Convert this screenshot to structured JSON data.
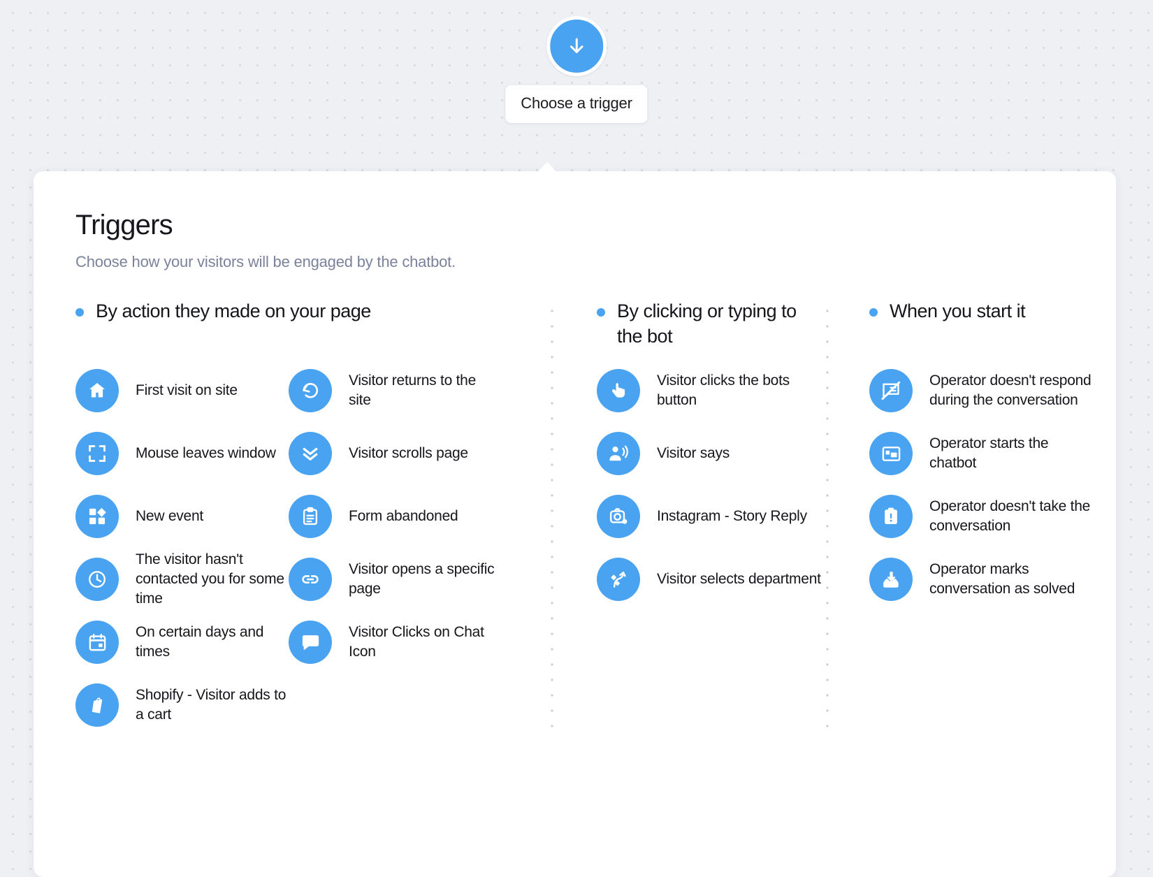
{
  "colors": {
    "accent": "#4aa3f0",
    "card_bg": "#ffffff",
    "page_bg": "#eef0f4",
    "title": "#16161c",
    "subtitle": "#7b829a"
  },
  "trigger_node": {
    "icon": "arrow-down-icon",
    "label": "Choose a trigger"
  },
  "card": {
    "title": "Triggers",
    "subtitle": "Choose how your visitors will be engaged by the chatbot."
  },
  "groups": [
    {
      "title": "By action they made on your page",
      "bullet": "bullet-dot",
      "columns": [
        {
          "items": [
            {
              "icon": "home-icon",
              "label": "First visit on site"
            },
            {
              "icon": "fullscreen-exit-icon",
              "label": "Mouse leaves window"
            },
            {
              "icon": "widgets-icon",
              "label": "New event"
            },
            {
              "icon": "clock-icon",
              "label": "The visitor hasn't contacted you for some time"
            },
            {
              "icon": "calendar-icon",
              "label": "On certain days and times"
            },
            {
              "icon": "shopify-bag-icon",
              "label": "Shopify - Visitor adds to a cart"
            }
          ]
        },
        {
          "items": [
            {
              "icon": "rotate-left-icon",
              "label": "Visitor returns to the site"
            },
            {
              "icon": "double-chevron-down-icon",
              "label": "Visitor scrolls page"
            },
            {
              "icon": "clipboard-icon",
              "label": "Form abandoned"
            },
            {
              "icon": "link-icon",
              "label": "Visitor opens a specific page"
            },
            {
              "icon": "chat-bubble-icon",
              "label": "Visitor Clicks on Chat Icon"
            }
          ]
        }
      ]
    },
    {
      "title": "By clicking or typing to the bot",
      "bullet": "bullet-dot",
      "columns": [
        {
          "items": [
            {
              "icon": "tap-pointer-icon",
              "label": "Visitor clicks the bots button"
            },
            {
              "icon": "person-speaking-icon",
              "label": "Visitor says"
            },
            {
              "icon": "instagram-camera-icon",
              "label": "Instagram - Story Reply"
            },
            {
              "icon": "branch-split-icon",
              "label": "Visitor selects department"
            }
          ]
        }
      ]
    },
    {
      "title": "When you start it",
      "bullet": "bullet-dot",
      "columns": [
        {
          "items": [
            {
              "icon": "chat-no-reply-icon",
              "label": "Operator doesn't respond during the conversation"
            },
            {
              "icon": "chat-window-icon",
              "label": "Operator starts the chatbot"
            },
            {
              "icon": "clipboard-alert-icon",
              "label": "Operator doesn't take the conversation"
            },
            {
              "icon": "inbox-download-icon",
              "label": "Operator marks conversation as solved"
            }
          ]
        }
      ]
    }
  ]
}
